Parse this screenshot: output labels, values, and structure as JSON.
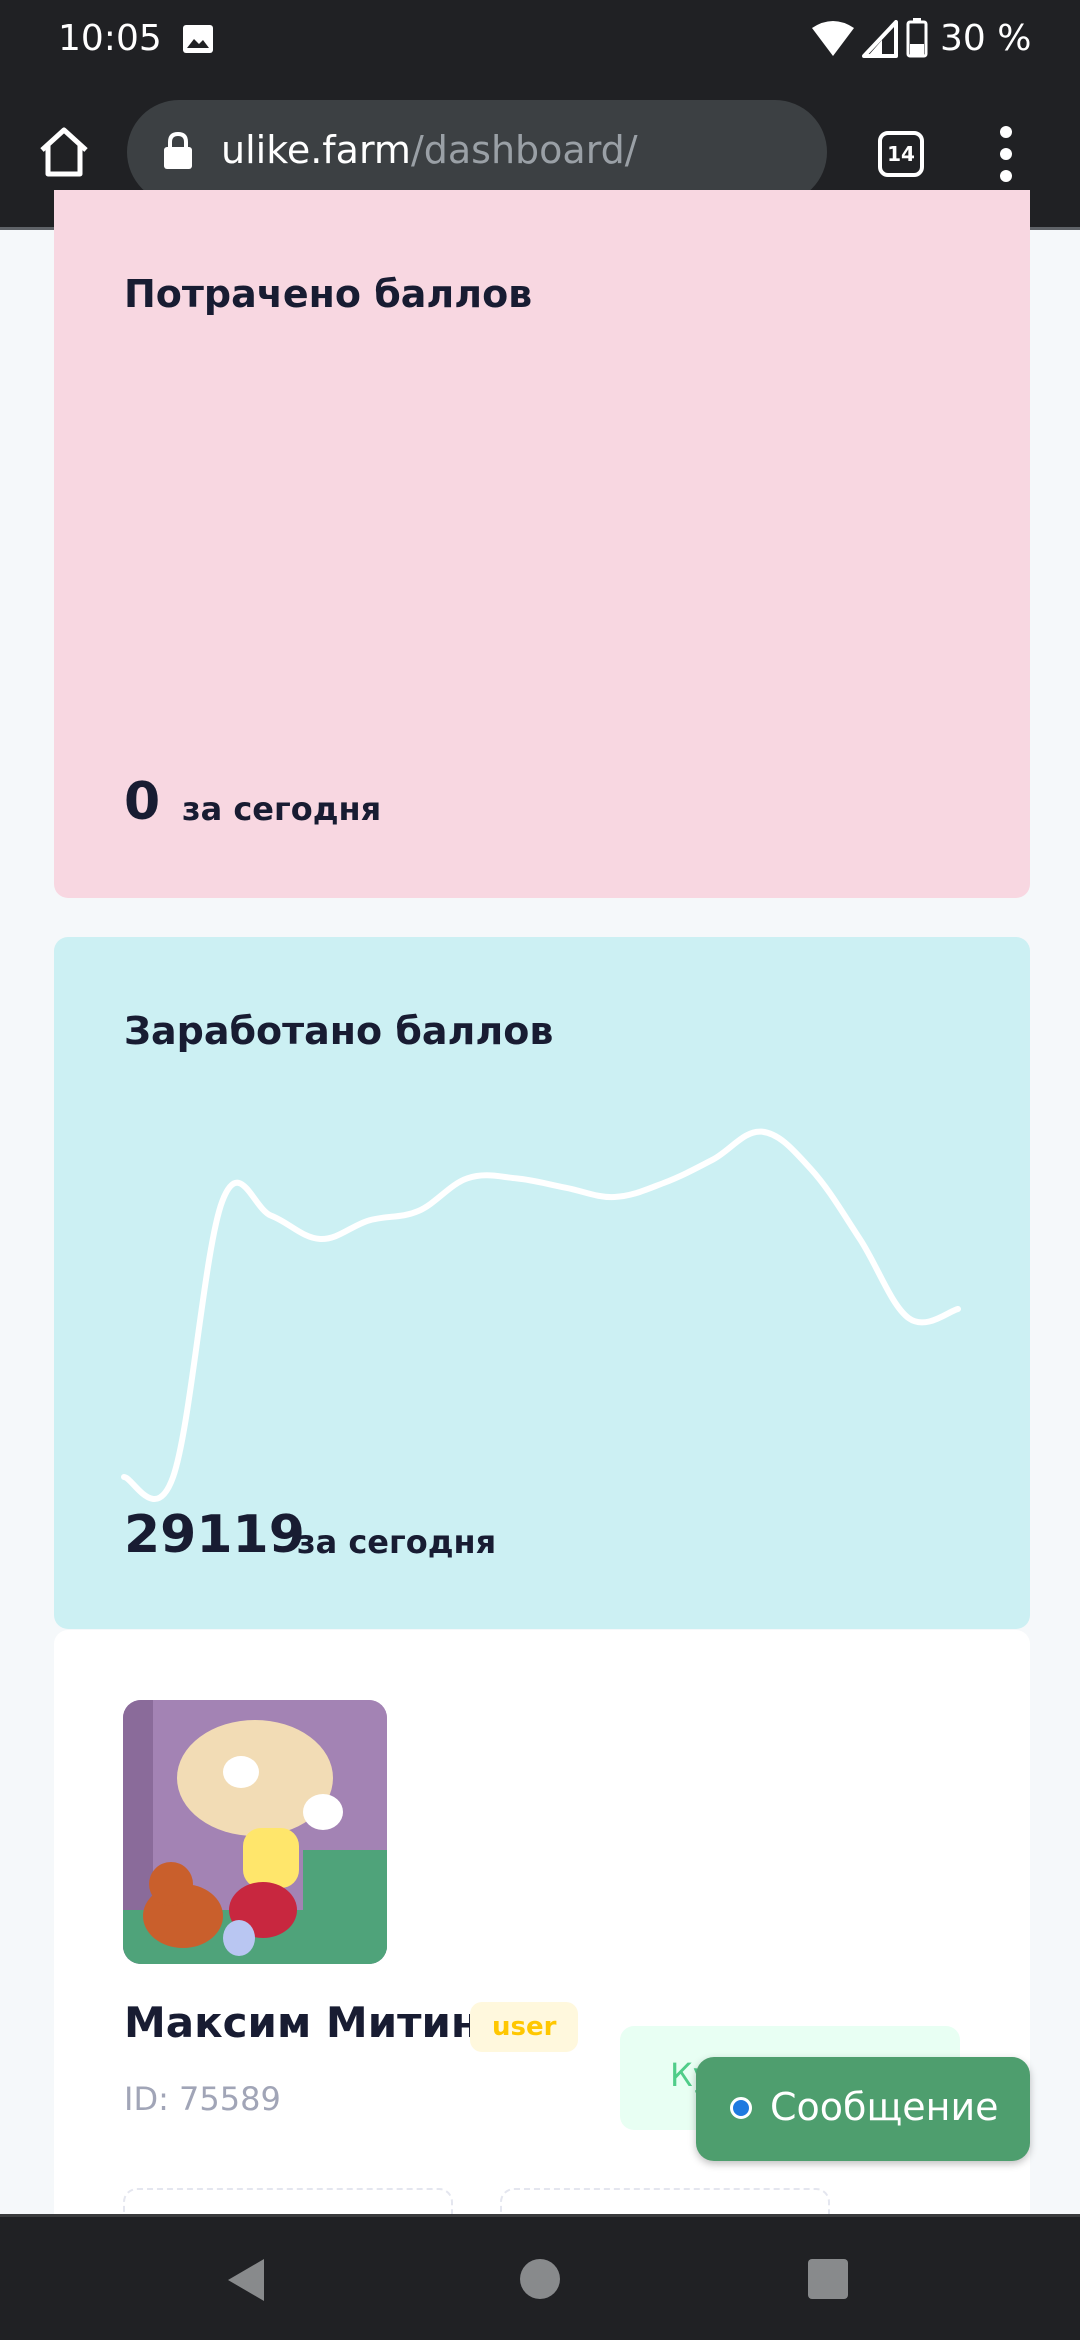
{
  "status_bar": {
    "time": "10:05",
    "battery": "30 %",
    "icons": [
      "image-icon",
      "wifi-icon",
      "cellular-signal-icon",
      "battery-icon"
    ]
  },
  "browser": {
    "url_domain": "ulike.farm",
    "url_path": "/dashboard/",
    "tab_count": "14",
    "icons": [
      "home-icon",
      "lock-icon",
      "more-vert-icon"
    ]
  },
  "spent_card": {
    "title": "Потрачено баллов",
    "value": "0",
    "suffix": "за сегодня",
    "color": "#f8d7e1"
  },
  "earned_card": {
    "title": "Заработано баллов",
    "value": "29119",
    "suffix": "за сегодня",
    "color": "#ccf0f3"
  },
  "chart_data": {
    "type": "line",
    "title": "",
    "xlabel": "",
    "ylabel": "",
    "grid": false,
    "legend": "none",
    "line_color": "#ffffff",
    "series": [
      {
        "values": [
          0,
          0,
          59,
          56,
          51,
          55,
          57,
          64,
          64,
          62,
          60,
          63,
          68,
          74,
          66,
          51,
          34,
          36
        ]
      }
    ],
    "ylim": [
      0,
      90
    ]
  },
  "profile": {
    "name": "Максим Митин",
    "role": "user",
    "id_label": "ID: 75589",
    "buy_button": "Ку"
  },
  "message_button": {
    "label": "Сообщение"
  },
  "nav_bar": {
    "icons": [
      "back-icon",
      "home-circle-icon",
      "recents-square-icon"
    ]
  }
}
